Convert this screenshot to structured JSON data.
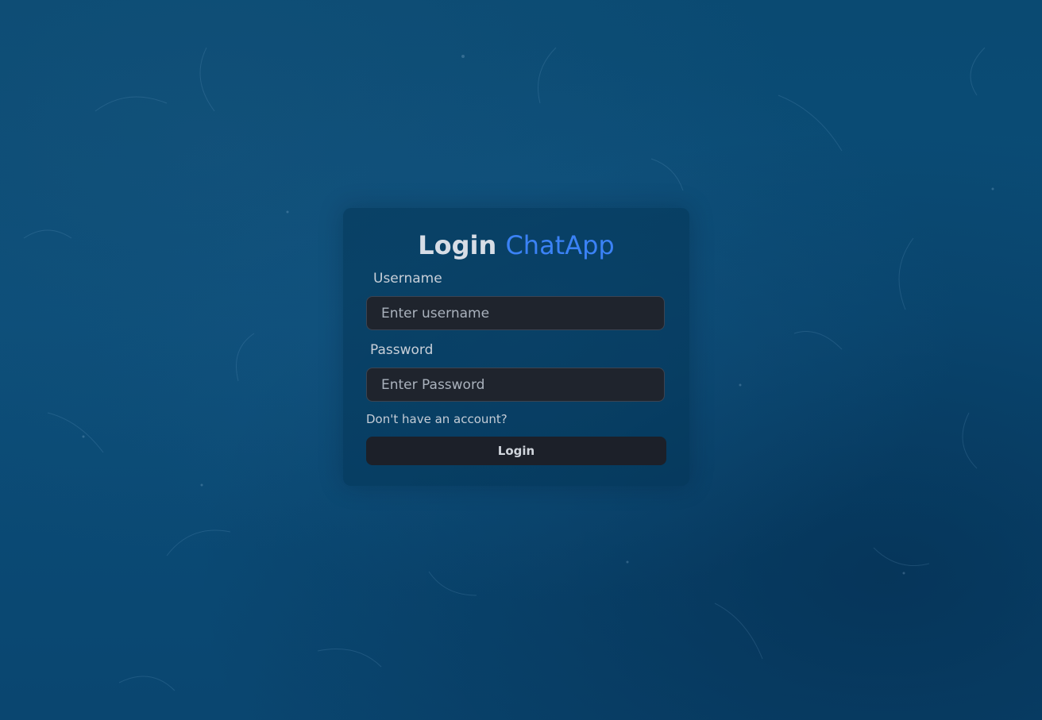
{
  "colors": {
    "background": "#0b4d78",
    "accent": "#3b82f6",
    "input_bg": "#1f242d",
    "button_bg": "#1c2029"
  },
  "login_form": {
    "title_prefix": "Login",
    "title_brand": "ChatApp",
    "username_label": "Username",
    "username_placeholder": "Enter username",
    "username_value": "",
    "password_label": "Password",
    "password_placeholder": "Enter Password",
    "password_value": "",
    "signup_link": "Don't have an account?",
    "submit_label": "Login"
  }
}
